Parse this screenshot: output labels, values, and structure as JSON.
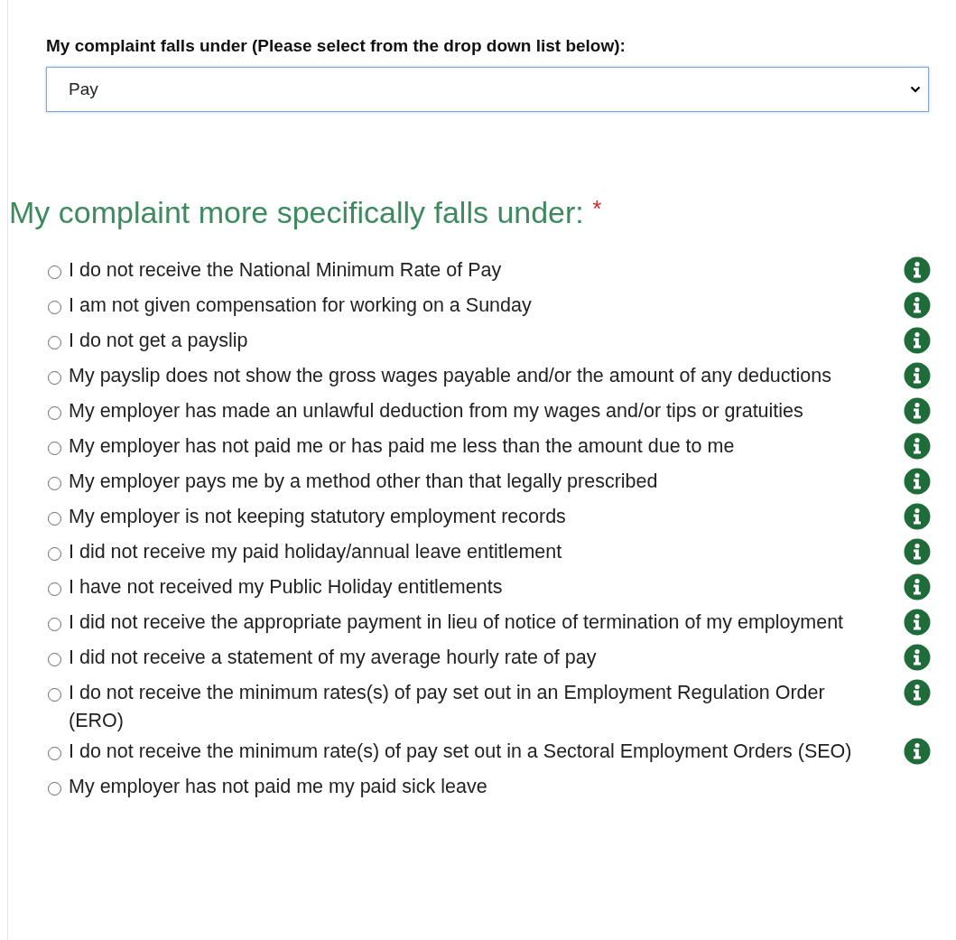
{
  "category": {
    "label": "My complaint falls under (Please select from the drop down list below):",
    "value": "Pay"
  },
  "specific": {
    "heading": "My complaint more specifically falls under:",
    "required_mark": "*",
    "options": [
      {
        "label": "I do not receive the National Minimum Rate of Pay",
        "selected": false,
        "info": true
      },
      {
        "label": "I am not given compensation for working on a Sunday",
        "selected": false,
        "info": true
      },
      {
        "label": "I do not get a payslip",
        "selected": false,
        "info": true
      },
      {
        "label": "My payslip does not show the gross wages payable and/or the amount of any deductions",
        "selected": false,
        "info": true
      },
      {
        "label": "My employer has made an unlawful deduction from my wages and/or tips or gratuities",
        "selected": false,
        "info": true
      },
      {
        "label": "My employer has not paid me or has paid me less than the amount due to me",
        "selected": false,
        "info": true
      },
      {
        "label": "My employer pays me by a method other than that legally prescribed",
        "selected": false,
        "info": true
      },
      {
        "label": "My employer is not keeping statutory employment records",
        "selected": false,
        "info": true
      },
      {
        "label": "I did not receive my paid holiday/annual leave entitlement",
        "selected": false,
        "info": true
      },
      {
        "label": "I have not received my Public Holiday entitlements",
        "selected": false,
        "info": true
      },
      {
        "label": "I did not receive the appropriate payment in lieu of notice of termination of my employment",
        "selected": false,
        "info": true
      },
      {
        "label": "I did not receive a statement of my average hourly rate of pay",
        "selected": false,
        "info": true
      },
      {
        "label": "I do not receive the minimum rates(s) of pay set out in an Employment Regulation Order (ERO)",
        "selected": false,
        "info": true
      },
      {
        "label": "I do not receive the minimum rate(s) of pay set out in a Sectoral Employment Orders (SEO)",
        "selected": false,
        "info": true
      },
      {
        "label": "My employer has not paid me my paid sick leave",
        "selected": false,
        "info": false
      }
    ]
  }
}
